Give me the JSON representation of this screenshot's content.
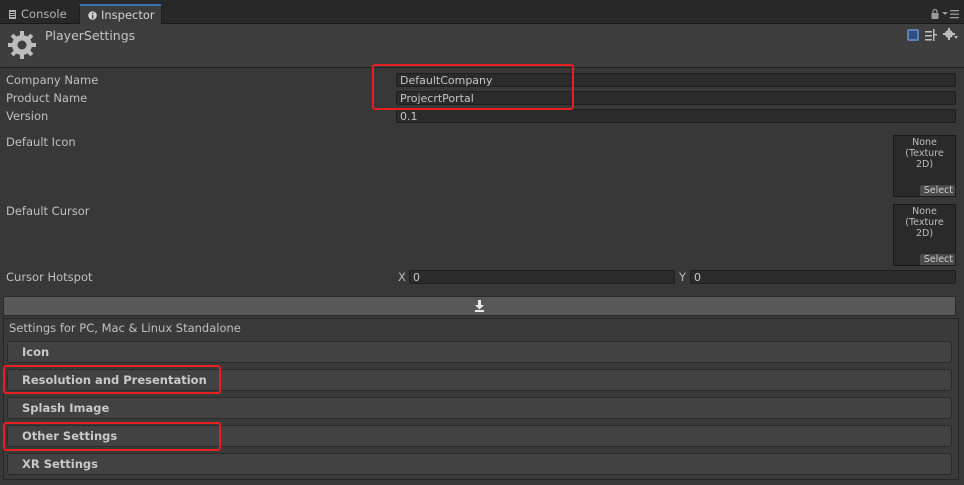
{
  "tabs": [
    {
      "label": "Console",
      "icon": "console-icon",
      "active": false
    },
    {
      "label": "Inspector",
      "icon": "info-icon",
      "active": true
    }
  ],
  "header": {
    "title": "PlayerSettings"
  },
  "fields": {
    "company_name": {
      "label": "Company Name",
      "value": "DefaultCompany"
    },
    "product_name": {
      "label": "Product Name",
      "value": "ProjecrtPortal"
    },
    "version": {
      "label": "Version",
      "value": "0.1"
    }
  },
  "default_icon": {
    "label": "Default Icon",
    "slot_text": "None\n(Texture\n2D)",
    "select_label": "Select"
  },
  "default_cursor": {
    "label": "Default Cursor",
    "slot_text": "None\n(Texture\n2D)",
    "select_label": "Select"
  },
  "cursor_hotspot": {
    "label": "Cursor Hotspot",
    "x_label": "X",
    "x_value": "0",
    "y_label": "Y",
    "y_value": "0"
  },
  "platform": {
    "title": "Settings for PC, Mac & Linux Standalone"
  },
  "sections": [
    "Icon",
    "Resolution and Presentation",
    "Splash Image",
    "Other Settings",
    "XR Settings"
  ],
  "colors": {
    "highlight": "#e62020",
    "active_tab_accent": "#3a72b0",
    "background": "#383838"
  }
}
